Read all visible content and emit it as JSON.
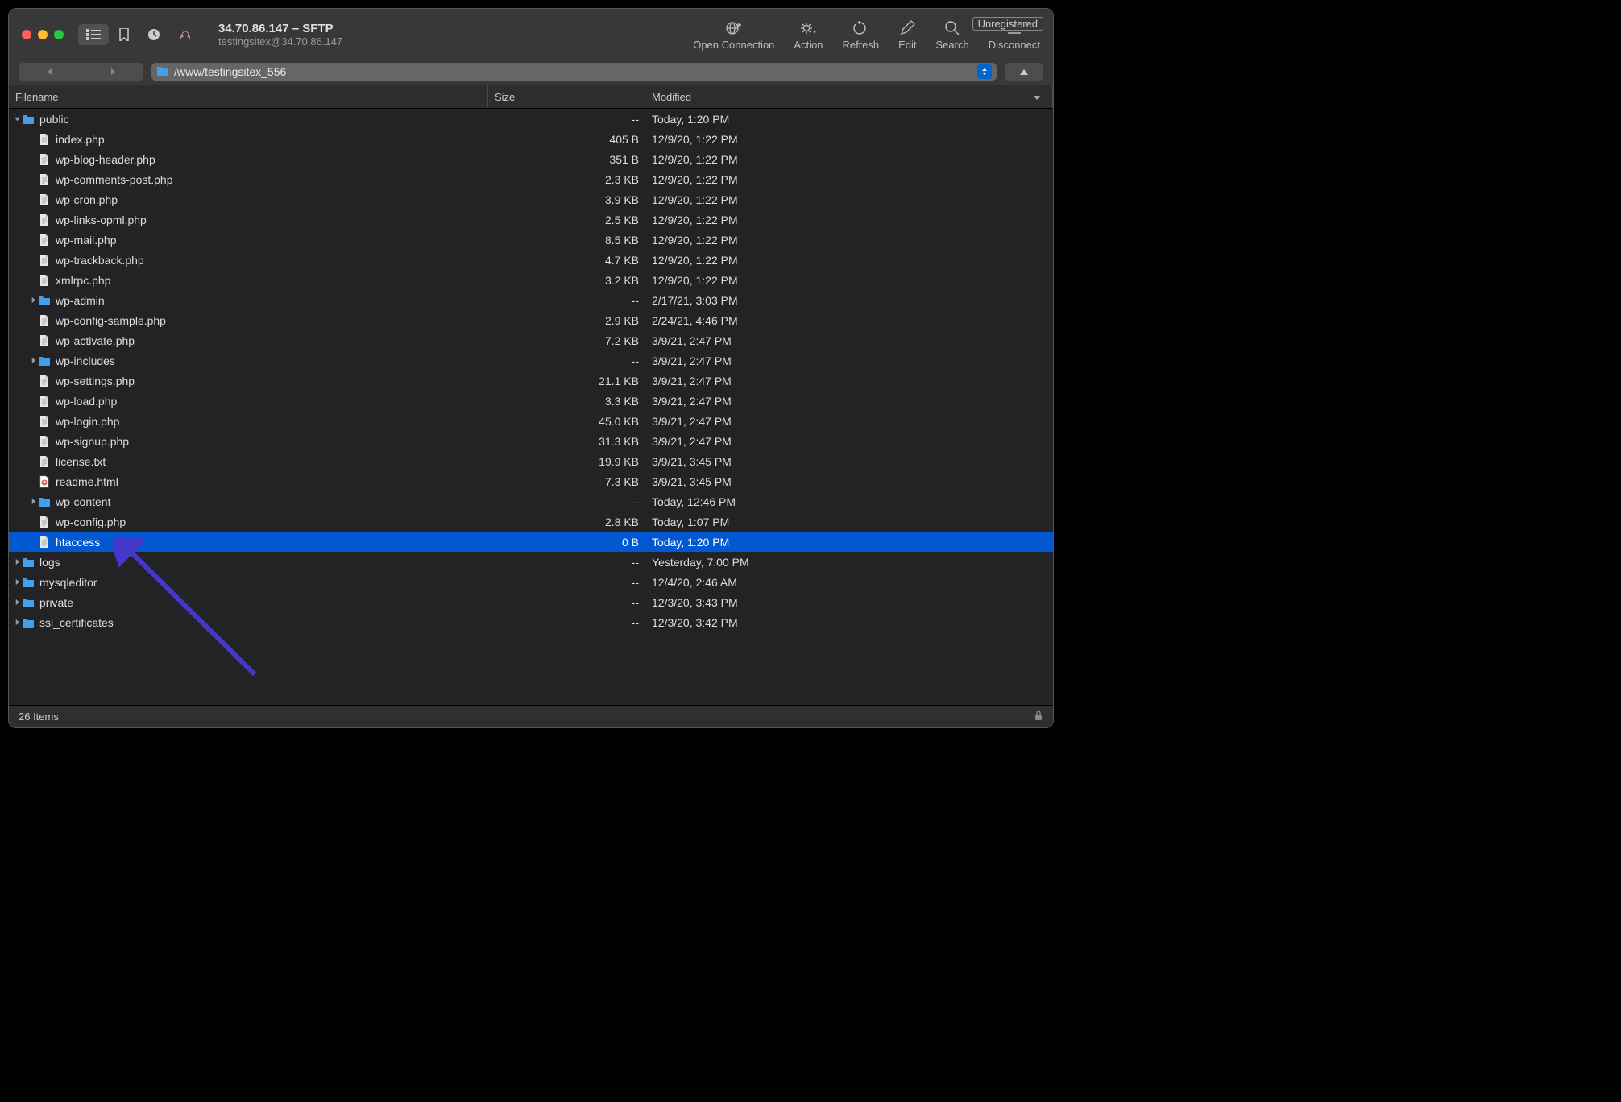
{
  "window": {
    "title": "34.70.86.147 – SFTP",
    "subtitle": "testingsitex@34.70.86.147",
    "unregistered": "Unregistered"
  },
  "toolbar": {
    "open_connection": "Open Connection",
    "action": "Action",
    "refresh": "Refresh",
    "edit": "Edit",
    "search": "Search",
    "disconnect": "Disconnect"
  },
  "path": "/www/testingsitex_556",
  "columns": {
    "filename": "Filename",
    "size": "Size",
    "modified": "Modified"
  },
  "files": [
    {
      "indent": 0,
      "disclosure": "down",
      "type": "folder",
      "name": "public",
      "size": "--",
      "modified": "Today, 1:20 PM",
      "selected": false
    },
    {
      "indent": 1,
      "disclosure": "",
      "type": "file",
      "name": "index.php",
      "size": "405 B",
      "modified": "12/9/20, 1:22 PM"
    },
    {
      "indent": 1,
      "disclosure": "",
      "type": "file",
      "name": "wp-blog-header.php",
      "size": "351 B",
      "modified": "12/9/20, 1:22 PM"
    },
    {
      "indent": 1,
      "disclosure": "",
      "type": "file",
      "name": "wp-comments-post.php",
      "size": "2.3 KB",
      "modified": "12/9/20, 1:22 PM"
    },
    {
      "indent": 1,
      "disclosure": "",
      "type": "file",
      "name": "wp-cron.php",
      "size": "3.9 KB",
      "modified": "12/9/20, 1:22 PM"
    },
    {
      "indent": 1,
      "disclosure": "",
      "type": "file",
      "name": "wp-links-opml.php",
      "size": "2.5 KB",
      "modified": "12/9/20, 1:22 PM"
    },
    {
      "indent": 1,
      "disclosure": "",
      "type": "file",
      "name": "wp-mail.php",
      "size": "8.5 KB",
      "modified": "12/9/20, 1:22 PM"
    },
    {
      "indent": 1,
      "disclosure": "",
      "type": "file",
      "name": "wp-trackback.php",
      "size": "4.7 KB",
      "modified": "12/9/20, 1:22 PM"
    },
    {
      "indent": 1,
      "disclosure": "",
      "type": "file",
      "name": "xmlrpc.php",
      "size": "3.2 KB",
      "modified": "12/9/20, 1:22 PM"
    },
    {
      "indent": 1,
      "disclosure": "right",
      "type": "folder",
      "name": "wp-admin",
      "size": "--",
      "modified": "2/17/21, 3:03 PM"
    },
    {
      "indent": 1,
      "disclosure": "",
      "type": "file",
      "name": "wp-config-sample.php",
      "size": "2.9 KB",
      "modified": "2/24/21, 4:46 PM"
    },
    {
      "indent": 1,
      "disclosure": "",
      "type": "file",
      "name": "wp-activate.php",
      "size": "7.2 KB",
      "modified": "3/9/21, 2:47 PM"
    },
    {
      "indent": 1,
      "disclosure": "right",
      "type": "folder",
      "name": "wp-includes",
      "size": "--",
      "modified": "3/9/21, 2:47 PM"
    },
    {
      "indent": 1,
      "disclosure": "",
      "type": "file",
      "name": "wp-settings.php",
      "size": "21.1 KB",
      "modified": "3/9/21, 2:47 PM"
    },
    {
      "indent": 1,
      "disclosure": "",
      "type": "file",
      "name": "wp-load.php",
      "size": "3.3 KB",
      "modified": "3/9/21, 2:47 PM"
    },
    {
      "indent": 1,
      "disclosure": "",
      "type": "file",
      "name": "wp-login.php",
      "size": "45.0 KB",
      "modified": "3/9/21, 2:47 PM"
    },
    {
      "indent": 1,
      "disclosure": "",
      "type": "file",
      "name": "wp-signup.php",
      "size": "31.3 KB",
      "modified": "3/9/21, 2:47 PM"
    },
    {
      "indent": 1,
      "disclosure": "",
      "type": "file",
      "name": "license.txt",
      "size": "19.9 KB",
      "modified": "3/9/21, 3:45 PM"
    },
    {
      "indent": 1,
      "disclosure": "",
      "type": "html",
      "name": "readme.html",
      "size": "7.3 KB",
      "modified": "3/9/21, 3:45 PM"
    },
    {
      "indent": 1,
      "disclosure": "right",
      "type": "folder",
      "name": "wp-content",
      "size": "--",
      "modified": "Today, 12:46 PM"
    },
    {
      "indent": 1,
      "disclosure": "",
      "type": "file",
      "name": "wp-config.php",
      "size": "2.8 KB",
      "modified": "Today, 1:07 PM"
    },
    {
      "indent": 1,
      "disclosure": "",
      "type": "file",
      "name": "htaccess",
      "size": "0 B",
      "modified": "Today, 1:20 PM",
      "selected": true
    },
    {
      "indent": 0,
      "disclosure": "right",
      "type": "folder",
      "name": "logs",
      "size": "--",
      "modified": "Yesterday, 7:00 PM"
    },
    {
      "indent": 0,
      "disclosure": "right",
      "type": "folder",
      "name": "mysqleditor",
      "size": "--",
      "modified": "12/4/20, 2:46 AM"
    },
    {
      "indent": 0,
      "disclosure": "right",
      "type": "folder",
      "name": "private",
      "size": "--",
      "modified": "12/3/20, 3:43 PM"
    },
    {
      "indent": 0,
      "disclosure": "right",
      "type": "folder",
      "name": "ssl_certificates",
      "size": "--",
      "modified": "12/3/20, 3:42 PM"
    }
  ],
  "status": {
    "items": "26 Items"
  }
}
